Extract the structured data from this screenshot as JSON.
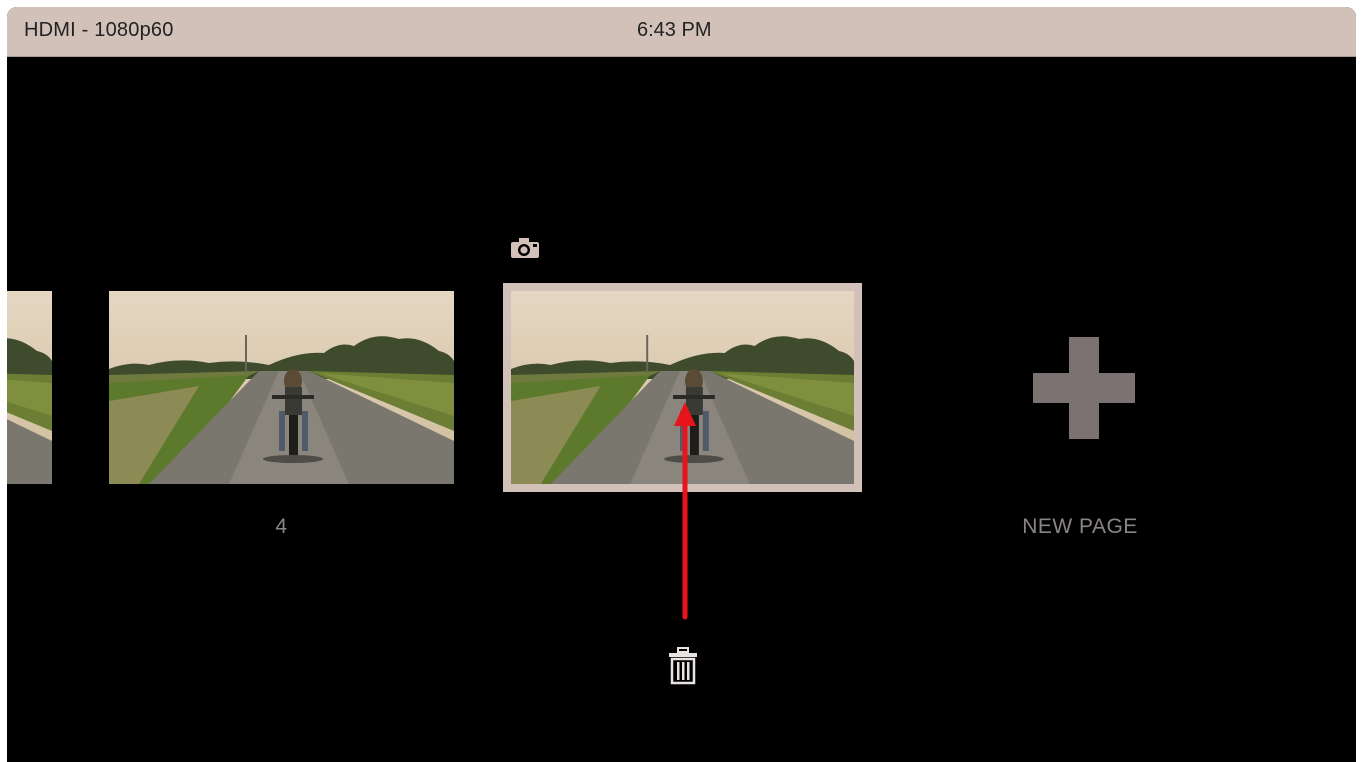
{
  "status_bar": {
    "source": "HDMI - 1080p60",
    "time": "6:43 PM"
  },
  "pages": [
    {
      "label": "",
      "state": "partial"
    },
    {
      "label": "4",
      "state": "normal"
    },
    {
      "label": "",
      "state": "selected"
    }
  ],
  "new_page": {
    "label": "NEW PAGE",
    "icon": "plus-icon"
  },
  "icons": {
    "selected_page": "camera-icon",
    "delete": "trash-icon"
  },
  "annotation": {
    "type": "arrow",
    "direction": "up",
    "color": "#e8141c"
  },
  "colors": {
    "status_bar": "#d2c1b8",
    "background": "#000000",
    "label": "#8a8583",
    "plus": "#7b7170",
    "selection_border": "#d2c1b8"
  }
}
